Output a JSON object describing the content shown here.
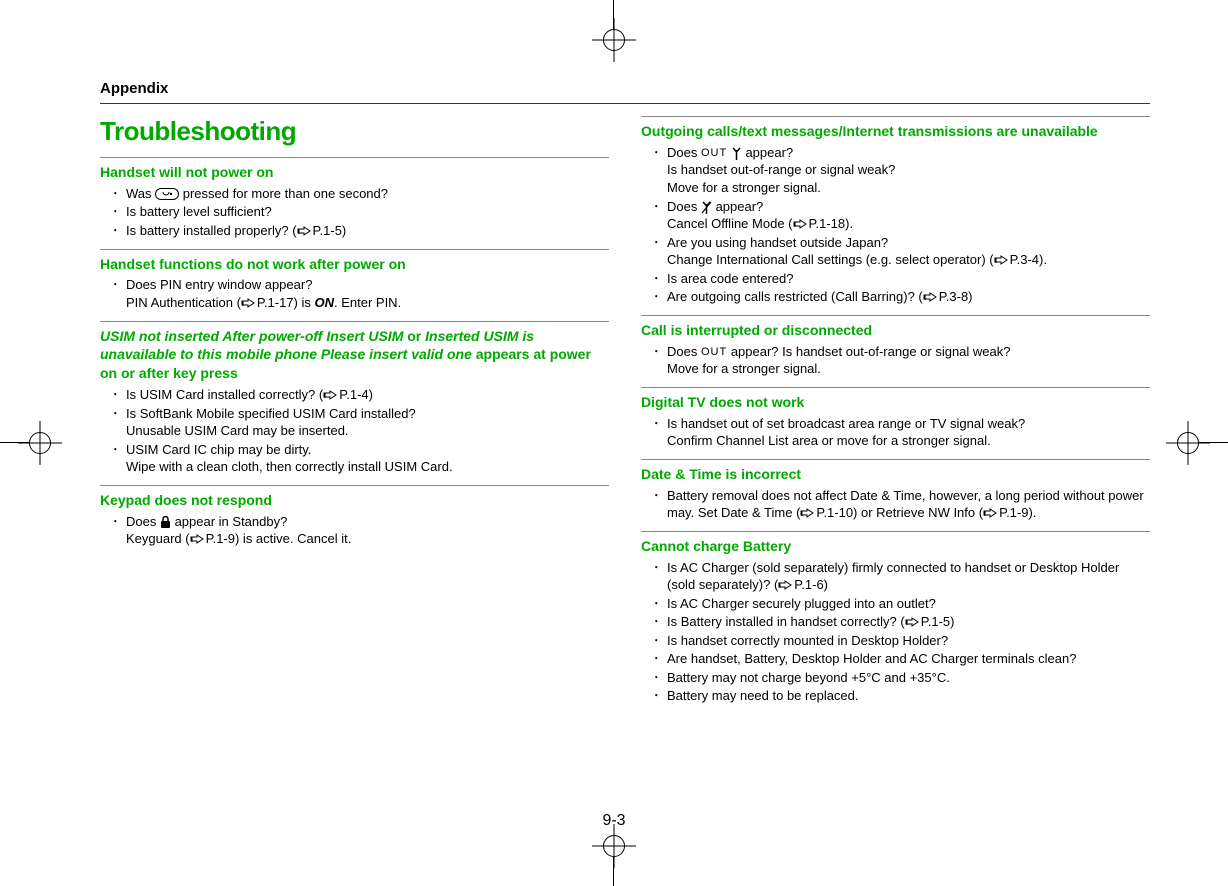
{
  "header": "Appendix",
  "title": "Troubleshooting",
  "page_number": "9-3",
  "left": [
    {
      "head_parts": [
        {
          "t": "Handset will not power on",
          "i": false
        }
      ],
      "items": [
        {
          "runs": [
            {
              "t": "Was "
            },
            {
              "icon": "power-button"
            },
            {
              "t": " pressed for more than one second?"
            }
          ]
        },
        {
          "runs": [
            {
              "t": "Is battery level sufficient?"
            }
          ]
        },
        {
          "runs": [
            {
              "t": "Is battery installed properly? ("
            },
            {
              "icon": "ref"
            },
            {
              "t": "P.1-5)"
            }
          ]
        }
      ]
    },
    {
      "head_parts": [
        {
          "t": "Handset functions do not work after power on",
          "i": false
        }
      ],
      "items": [
        {
          "runs": [
            {
              "t": "Does PIN entry window appear?"
            }
          ],
          "sub": [
            {
              "t": "PIN Authentication ("
            },
            {
              "icon": "ref"
            },
            {
              "t": "P.1-17) is "
            },
            {
              "t": "ON",
              "cls": "bold-ital"
            },
            {
              "t": ". Enter PIN."
            }
          ]
        }
      ]
    },
    {
      "head_parts": [
        {
          "t": "USIM not inserted After power-off Insert USIM",
          "i": true
        },
        {
          "t": " or ",
          "i": false
        },
        {
          "t": "Inserted USIM is unavailable to this mobile phone Please insert valid one",
          "i": true
        },
        {
          "t": " appears at power on or after key press",
          "i": false
        }
      ],
      "items": [
        {
          "runs": [
            {
              "t": "Is USIM Card installed correctly? ("
            },
            {
              "icon": "ref"
            },
            {
              "t": "P.1-4)"
            }
          ]
        },
        {
          "runs": [
            {
              "t": "Is SoftBank Mobile specified USIM Card installed?"
            }
          ],
          "sub": [
            {
              "t": "Unusable USIM Card may be inserted."
            }
          ]
        },
        {
          "runs": [
            {
              "t": "USIM Card IC chip may be dirty."
            }
          ],
          "sub": [
            {
              "t": "Wipe with a clean cloth, then correctly install USIM Card."
            }
          ]
        }
      ]
    },
    {
      "head_parts": [
        {
          "t": "Keypad does not respond",
          "i": false
        }
      ],
      "items": [
        {
          "runs": [
            {
              "t": "Does "
            },
            {
              "icon": "lock"
            },
            {
              "t": " appear in Standby?"
            }
          ],
          "sub": [
            {
              "t": "Keyguard ("
            },
            {
              "icon": "ref"
            },
            {
              "t": "P.1-9) is active. Cancel it."
            }
          ]
        }
      ]
    }
  ],
  "right": [
    {
      "head_parts": [
        {
          "t": "Outgoing calls/text messages/Internet transmissions are unavailable",
          "i": false
        }
      ],
      "items": [
        {
          "runs": [
            {
              "t": "Does "
            },
            {
              "icon": "out"
            },
            {
              "t": " "
            },
            {
              "icon": "antenna"
            },
            {
              "t": " appear?"
            }
          ],
          "sub": [
            {
              "t": "Is handset out-of-range or signal weak?"
            },
            {
              "br": true
            },
            {
              "t": "Move for a stronger signal."
            }
          ]
        },
        {
          "runs": [
            {
              "t": "Does "
            },
            {
              "icon": "antenna-x"
            },
            {
              "t": " appear?"
            }
          ],
          "sub": [
            {
              "t": "Cancel Offline Mode ("
            },
            {
              "icon": "ref"
            },
            {
              "t": "P.1-18)."
            }
          ]
        },
        {
          "runs": [
            {
              "t": "Are you using handset outside Japan?"
            }
          ],
          "sub": [
            {
              "t": "Change International Call settings (e.g. select operator) ("
            },
            {
              "icon": "ref"
            },
            {
              "t": "P.3-4)."
            }
          ]
        },
        {
          "runs": [
            {
              "t": "Is area code entered?"
            }
          ]
        },
        {
          "runs": [
            {
              "t": "Are outgoing calls restricted (Call Barring)? ("
            },
            {
              "icon": "ref"
            },
            {
              "t": "P.3-8)"
            }
          ]
        }
      ]
    },
    {
      "head_parts": [
        {
          "t": "Call is interrupted or disconnected",
          "i": false
        }
      ],
      "items": [
        {
          "runs": [
            {
              "t": "Does "
            },
            {
              "icon": "out"
            },
            {
              "t": " appear? Is handset out-of-range or signal weak?"
            }
          ],
          "sub": [
            {
              "t": "Move for a stronger signal."
            }
          ]
        }
      ]
    },
    {
      "head_parts": [
        {
          "t": "Digital TV does not work",
          "i": false
        }
      ],
      "items": [
        {
          "runs": [
            {
              "t": "Is handset out of set broadcast area range or TV signal weak?"
            }
          ],
          "sub": [
            {
              "t": "Confirm Channel List area or move for a stronger signal."
            }
          ]
        }
      ]
    },
    {
      "head_parts": [
        {
          "t": "Date & Time is incorrect",
          "i": false
        }
      ],
      "items": [
        {
          "runs": [
            {
              "t": "Battery removal does not affect Date & Time, however, a long period without power may. Set Date & Time ("
            },
            {
              "icon": "ref"
            },
            {
              "t": "P.1-10) or Retrieve NW Info ("
            },
            {
              "icon": "ref"
            },
            {
              "t": "P.1-9)."
            }
          ]
        }
      ]
    },
    {
      "head_parts": [
        {
          "t": "Cannot charge Battery",
          "i": false
        }
      ],
      "items": [
        {
          "runs": [
            {
              "t": "Is AC Charger (sold separately) firmly connected to handset or Desktop Holder (sold separately)? ("
            },
            {
              "icon": "ref"
            },
            {
              "t": "P.1-6)"
            }
          ]
        },
        {
          "runs": [
            {
              "t": "Is AC Charger securely plugged into an outlet?"
            }
          ]
        },
        {
          "runs": [
            {
              "t": "Is Battery installed in handset correctly? ("
            },
            {
              "icon": "ref"
            },
            {
              "t": "P.1-5)"
            }
          ]
        },
        {
          "runs": [
            {
              "t": "Is handset correctly mounted in Desktop Holder?"
            }
          ]
        },
        {
          "runs": [
            {
              "t": "Are handset, Battery, Desktop Holder and AC Charger terminals clean?"
            }
          ]
        },
        {
          "runs": [
            {
              "t": "Battery may not charge beyond +5°C and +35°C."
            }
          ]
        },
        {
          "runs": [
            {
              "t": "Battery may need to be replaced."
            }
          ]
        }
      ]
    }
  ]
}
